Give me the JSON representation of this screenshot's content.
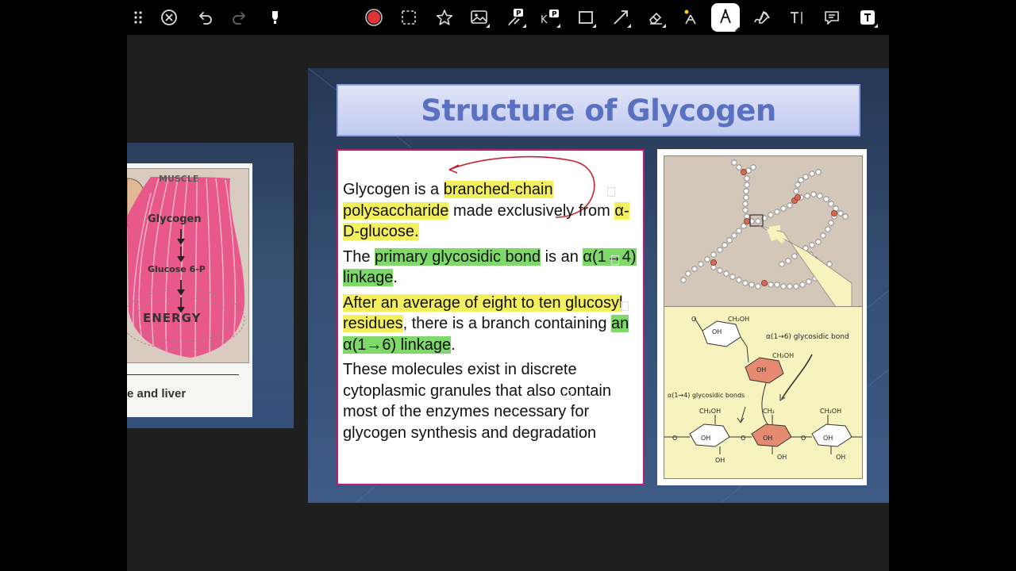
{
  "toolbar": {
    "items": [
      {
        "icon": "more-grip-icon"
      },
      {
        "icon": "close-icon"
      },
      {
        "icon": "undo-icon"
      },
      {
        "icon": "redo-icon"
      },
      {
        "icon": "highlighter-icon"
      },
      {
        "icon": "color-picker-icon",
        "color": "#e0343a"
      },
      {
        "icon": "lasso-select-icon"
      },
      {
        "icon": "star-icon"
      },
      {
        "icon": "image-icon"
      },
      {
        "icon": "pen-tool-icon"
      },
      {
        "icon": "keyboard-tool-icon"
      },
      {
        "icon": "rectangle-icon"
      },
      {
        "icon": "line-icon"
      },
      {
        "icon": "eraser-icon"
      },
      {
        "icon": "laser-pointer-icon"
      },
      {
        "icon": "fountain-pen-icon"
      },
      {
        "icon": "ink-pen-icon"
      },
      {
        "icon": "text-cursor-icon"
      },
      {
        "icon": "comment-icon"
      },
      {
        "icon": "text-box-icon"
      }
    ]
  },
  "left_slide": {
    "muscle_label": "MUSCLE",
    "glycogen_label": "Glycogen",
    "glucose_label": "Glucose 6-P",
    "energy_label": "ENERGY",
    "caption": "e and liver"
  },
  "slide": {
    "title": "Structure of Glycogen",
    "p1": {
      "t1": "Glycogen is a ",
      "h1": "branched-chain polysaccharide",
      "t2": " made exclusively from ",
      "h2": "α-D-glucose."
    },
    "p2": {
      "t1": "The ",
      "h1": "primary glycosidic bond",
      "t2": " is an ",
      "h2": "α(1→4) linkage",
      "t3": "."
    },
    "p3": {
      "h1": "After an average of eight to ten glucosyl residues",
      "t1": ", there is a branch containing ",
      "h2": "an α(1→6) linkage",
      "t2": "."
    },
    "p4": "These molecules exist in discrete cytoplasmic granules that also contain most of the enzymes necessary for glycogen synthesis and degradation",
    "figure": {
      "bond16_label": "α(1→6) glycosidic bond",
      "bond14_label": "α(1→4) glycosidic bonds",
      "ch2oh": "CH₂OH",
      "ch2": "CH₂",
      "oh": "OH",
      "o": "O"
    }
  },
  "colors": {
    "highlight_yellow": "#f4ef5c",
    "highlight_green": "#7fd96a",
    "annotation_red": "#c8202e",
    "title_text": "#5a70c0",
    "text_box_border": "#c01a78"
  }
}
